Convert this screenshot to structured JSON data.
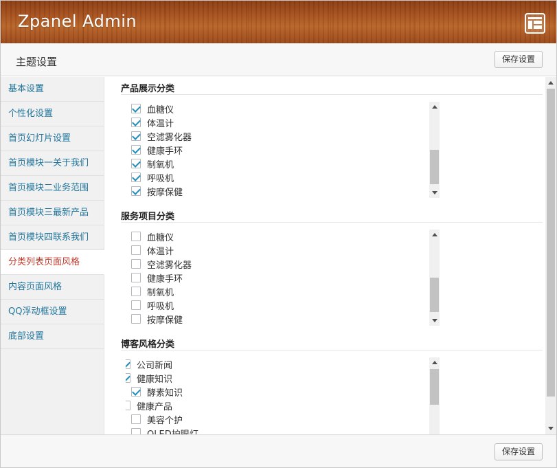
{
  "header": {
    "title": "Zpanel  Admin",
    "icon": "layout-icon"
  },
  "titlebar": {
    "title": "主题设置",
    "save_label": "保存设置"
  },
  "sidebar": {
    "items": [
      {
        "label": "基本设置"
      },
      {
        "label": "个性化设置"
      },
      {
        "label": "首页幻灯片设置"
      },
      {
        "label": "首页模块一关于我们"
      },
      {
        "label": "首页模块二业务范围"
      },
      {
        "label": "首页模块三最新产品"
      },
      {
        "label": "首页模块四联系我们"
      },
      {
        "label": "分类列表页面风格",
        "active": true
      },
      {
        "label": "内容页面风格"
      },
      {
        "label": "QQ浮动框设置"
      },
      {
        "label": "底部设置"
      }
    ]
  },
  "sections": [
    {
      "title": "产品展示分类",
      "items": [
        {
          "label": "血糖仪",
          "checked": true
        },
        {
          "label": "体温计",
          "checked": true
        },
        {
          "label": "空滤雾化器",
          "checked": true
        },
        {
          "label": "健康手环",
          "checked": true
        },
        {
          "label": "制氧机",
          "checked": true
        },
        {
          "label": "呼吸机",
          "checked": true
        },
        {
          "label": "按摩保健",
          "checked": true
        }
      ]
    },
    {
      "title": "服务项目分类",
      "items": [
        {
          "label": "血糖仪",
          "checked": false
        },
        {
          "label": "体温计",
          "checked": false
        },
        {
          "label": "空滤雾化器",
          "checked": false
        },
        {
          "label": "健康手环",
          "checked": false
        },
        {
          "label": "制氧机",
          "checked": false
        },
        {
          "label": "呼吸机",
          "checked": false
        },
        {
          "label": "按摩保健",
          "checked": false
        }
      ]
    },
    {
      "title": "博客风格分类",
      "items": [
        {
          "label": "公司新闻",
          "checked": true,
          "level": 0
        },
        {
          "label": "健康知识",
          "checked": true,
          "level": 0
        },
        {
          "label": "酵素知识",
          "checked": true,
          "level": 1
        },
        {
          "label": "健康产品",
          "checked": false,
          "level": 0
        },
        {
          "label": "美容个护",
          "checked": false,
          "level": 1
        },
        {
          "label": "OLED护眼灯",
          "checked": false,
          "level": 1
        }
      ]
    }
  ],
  "footer": {
    "save_label": "保存设置"
  },
  "colors": {
    "link": "#21759b",
    "active": "#c0392b",
    "check": "#1e8cbe"
  }
}
